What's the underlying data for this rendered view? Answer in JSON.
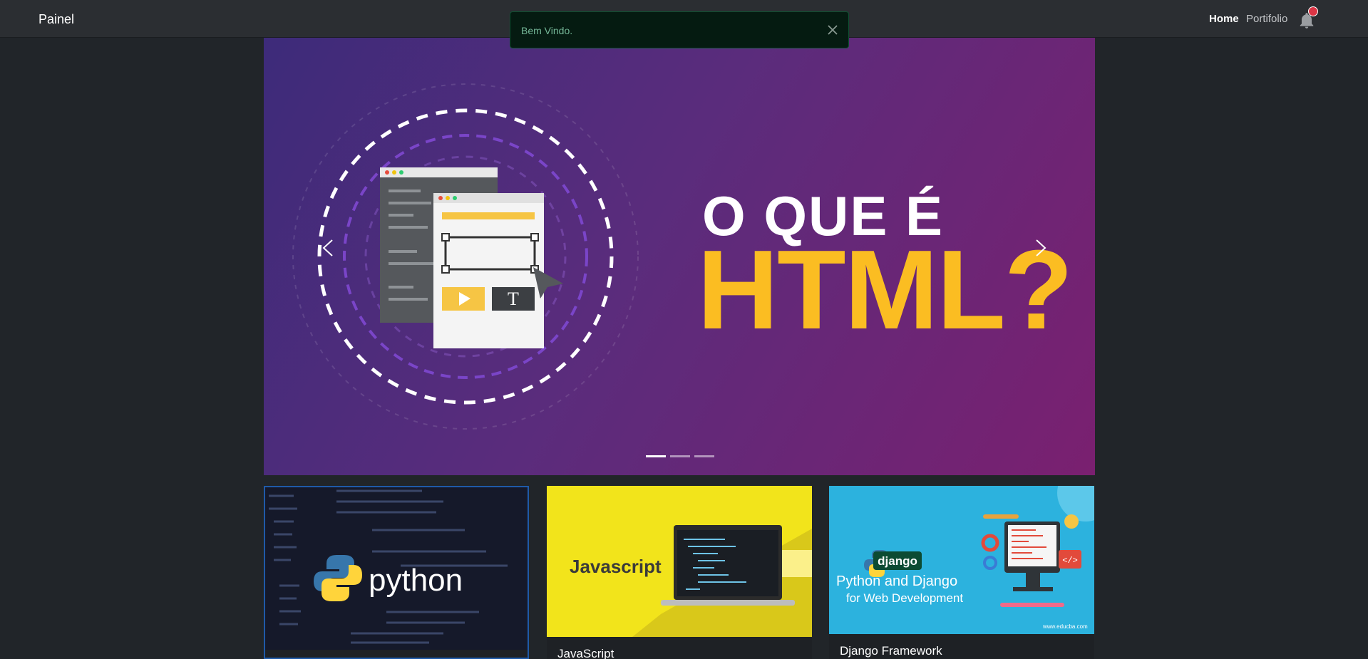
{
  "navbar": {
    "brand": "Painel",
    "links": [
      "Home",
      "Portifolio"
    ]
  },
  "toast": {
    "message": "Bem Vindo."
  },
  "carousel": {
    "slide": {
      "line1": "O QUE É",
      "line2": "HTML?"
    },
    "slides_count": 3,
    "active_index": 0
  },
  "cards": [
    {
      "image_text": "python",
      "title": ""
    },
    {
      "image_text": "Javascript",
      "title": "JavaScript"
    },
    {
      "image_text": "django",
      "image_caption1": "Python and Django",
      "image_caption2": "for Web Development",
      "image_footer": "www.educba.com",
      "title": "Django Framework"
    }
  ],
  "colors": {
    "accent_yellow": "#fbbd22",
    "toast_bg": "#051b11",
    "notification": "#dc3545"
  }
}
